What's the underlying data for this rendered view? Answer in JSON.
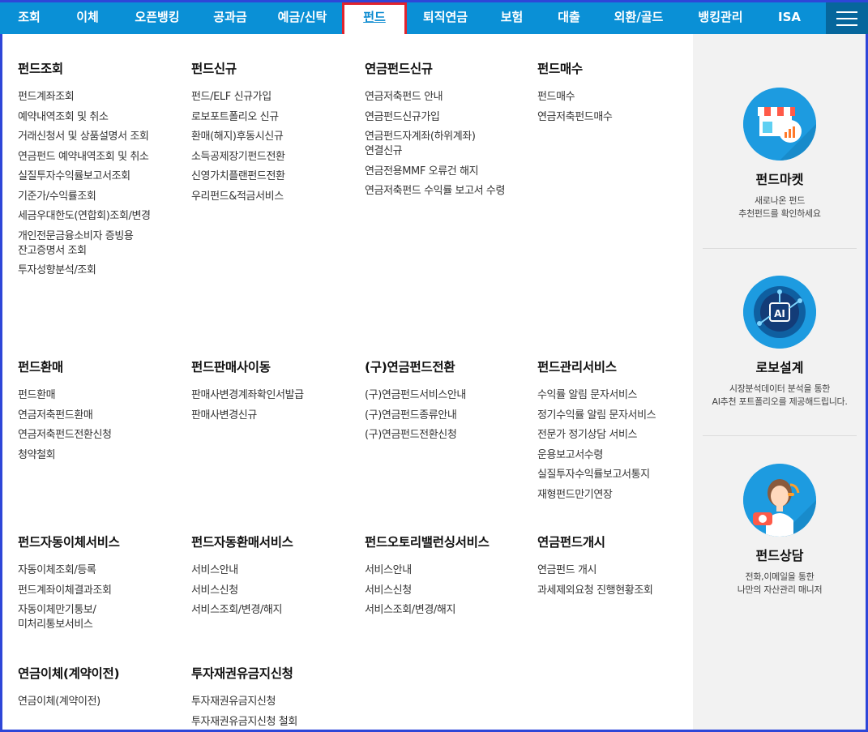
{
  "nav": {
    "items": [
      "조회",
      "이체",
      "오픈뱅킹",
      "공과금",
      "예금/신탁",
      "펀드",
      "퇴직연금",
      "보험",
      "대출",
      "외환/골드",
      "뱅킹관리",
      "ISA"
    ],
    "active": "펀드"
  },
  "groups": [
    {
      "title": "펀드조회",
      "items": [
        "펀드계좌조회",
        "예약내역조회 및 취소",
        "거래신청서 및 상품설명서 조회",
        "연금펀드 예약내역조회 및 취소",
        "실질투자수익률보고서조회",
        "기준가/수익률조회",
        "세금우대한도(연합회)조회/변경",
        "개인전문금융소비자 증빙용 잔고증명서 조회",
        "투자성향분석/조회"
      ]
    },
    {
      "title": "펀드신규",
      "items": [
        "펀드/ELF 신규가입",
        "로보포트폴리오 신규",
        "환매(해지)후동시신규",
        "소득공제장기펀드전환",
        "신영가치플랜펀드전환",
        "우리펀드&적금서비스"
      ]
    },
    {
      "title": "연금펀드신규",
      "items": [
        "연금저축펀드 안내",
        "연금펀드신규가입",
        "연금펀드자계좌(하위계좌)연결신규",
        "연금전용MMF 오류건 해지",
        "연금저축펀드 수익률 보고서 수령"
      ]
    },
    {
      "title": "펀드매수",
      "items": [
        "펀드매수",
        "연금저축펀드매수"
      ]
    },
    {
      "title": "펀드환매",
      "items": [
        "펀드환매",
        "연금저축펀드환매",
        "연금저축펀드전환신청",
        "청약철회"
      ]
    },
    {
      "title": "펀드판매사이동",
      "items": [
        "판매사변경계좌확인서발급",
        "판매사변경신규"
      ]
    },
    {
      "title": "(구)연금펀드전환",
      "items": [
        "(구)연금펀드서비스안내",
        "(구)연금펀드종류안내",
        "(구)연금펀드전환신청"
      ]
    },
    {
      "title": "펀드관리서비스",
      "items": [
        "수익률 알림 문자서비스",
        "정기수익률 알림 문자서비스",
        "전문가 정기상담 서비스",
        "운용보고서수령",
        "실질투자수익률보고서통지",
        "재형펀드만기연장"
      ]
    },
    {
      "title": "펀드자동이체서비스",
      "items": [
        "자동이체조회/등록",
        "펀드계좌이체결과조회",
        "자동이체만기통보/미처리통보서비스"
      ]
    },
    {
      "title": "펀드자동환매서비스",
      "items": [
        "서비스안내",
        "서비스신청",
        "서비스조회/변경/해지"
      ]
    },
    {
      "title": "펀드오토리밸런싱서비스",
      "items": [
        "서비스안내",
        "서비스신청",
        "서비스조회/변경/해지"
      ]
    },
    {
      "title": "연금펀드개시",
      "items": [
        "연금펀드 개시",
        "과세제외요청 진행현황조회"
      ]
    },
    {
      "title": "연금이체(계약이전)",
      "items": [
        "연금이체(계약이전)"
      ]
    },
    {
      "title": "투자재권유금지신청",
      "items": [
        "투자재권유금지신청",
        "투자재권유금지신청 철회"
      ]
    }
  ],
  "promos": [
    {
      "title": "펀드마켓",
      "desc1": "새로나온 펀드",
      "desc2": "추천펀드를 확인하세요",
      "icon": "fund-market-icon",
      "color": "#1d9be0"
    },
    {
      "title": "로보설계",
      "desc1": "시장분석데이터 분석을 통한",
      "desc2": "AI추천 포트폴리오를 제공해드립니다.",
      "icon": "ai-robo-icon",
      "color": "#1d9be0"
    },
    {
      "title": "펀드상담",
      "desc1": "전화,이메일을 통한",
      "desc2": "나만의 자산관리 매니저",
      "icon": "consultant-icon",
      "color": "#1d9be0"
    }
  ]
}
